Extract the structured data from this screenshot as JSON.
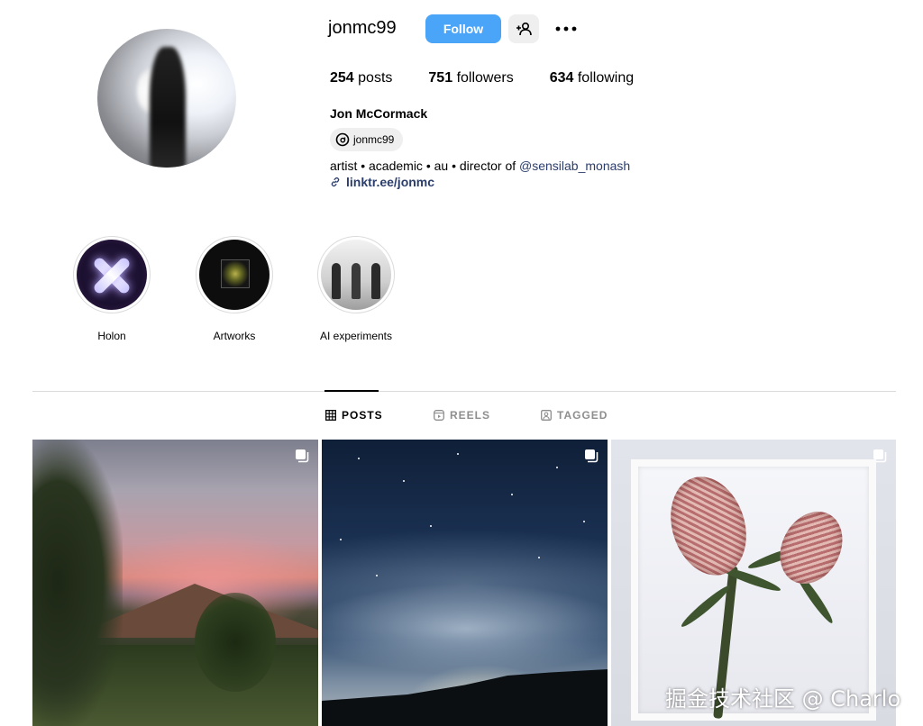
{
  "profile": {
    "username": "jonmc99",
    "follow_label": "Follow",
    "stats": [
      {
        "count": "254",
        "label": "posts"
      },
      {
        "count": "751",
        "label": "followers"
      },
      {
        "count": "634",
        "label": "following"
      }
    ],
    "full_name": "Jon McCormack",
    "threads_handle": "jonmc99",
    "bio_text": "artist • academic • au • director of ",
    "bio_mention": "@sensilab_monash",
    "link": "linktr.ee/jonmc"
  },
  "highlights": [
    {
      "label": "Holon"
    },
    {
      "label": "Artworks"
    },
    {
      "label": "AI experiments"
    }
  ],
  "tabs": [
    {
      "label": "POSTS",
      "icon": "grid-icon",
      "active": true
    },
    {
      "label": "REELS",
      "icon": "reels-icon",
      "active": false
    },
    {
      "label": "TAGGED",
      "icon": "tagged-icon",
      "active": false
    }
  ],
  "posts": [
    {
      "icon": "multiple-posts-icon"
    },
    {
      "icon": "multiple-posts-icon"
    },
    {
      "icon": "multiple-posts-icon"
    }
  ],
  "watermark": "掘金技术社区 @ Charlo",
  "colors": {
    "accent": "#4aa4f7",
    "link": "#2b3d6b",
    "muted": "#8e8e8e"
  }
}
